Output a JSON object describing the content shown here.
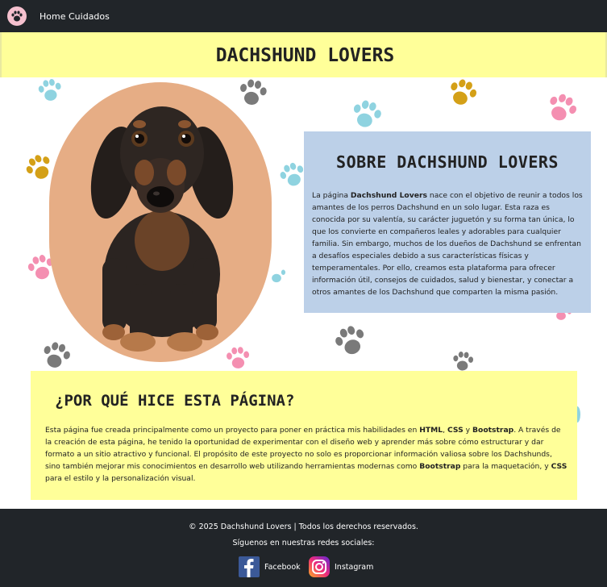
{
  "navbar": {
    "logo_icon": "paw-icon",
    "links": [
      "Home",
      "Cuidados"
    ]
  },
  "hero": {
    "title": "DACHSHUND LOVERS"
  },
  "about": {
    "title": "SOBRE DACHSHUND LOVERS",
    "text_parts": [
      "La página ",
      "Dachshund Lovers",
      " nace con el objetivo de reunir a todos los amantes de los perros Dachshund en un solo lugar. Esta raza es conocida por su valentía, su carácter juguetón y su forma tan única, lo que los convierte en compañeros leales y adorables para cualquier familia. Sin embargo, muchos de los dueños de Dachshund se enfrentan a desafíos especiales debido a sus características físicas y temperamentales. Por ello, creamos esta plataforma para ofrecer información útil, consejos de cuidados, salud y bienestar, y conectar a otros amantes de los Dachshund que comparten la misma pasión."
    ]
  },
  "why": {
    "title": "¿POR QUÉ HICE ESTA PÁGINA?",
    "text_parts": [
      "Esta página fue creada principalmente como un proyecto para poner en práctica mis habilidades en ",
      "HTML",
      ", ",
      "CSS",
      " y ",
      "Bootstrap",
      ". A través de la creación de esta página, he tenido la oportunidad de experimentar con el diseño web y aprender más sobre cómo estructurar y dar formato a un sitio atractivo y funcional. El propósito de este proyecto no solo es proporcionar información valiosa sobre los Dachshunds, sino también mejorar mis conocimientos en desarrollo web utilizando herramientas modernas como ",
      "Bootstrap",
      " para la maquetación, y ",
      "CSS",
      " para el estilo y la personalización visual."
    ]
  },
  "footer": {
    "copyright": "© 2025 Dachshund Lovers | Todos los derechos reservados.",
    "follow": "Síguenos en nuestras redes sociales:",
    "social": [
      {
        "label": "Facebook",
        "icon": "facebook-icon"
      },
      {
        "label": "Instagram",
        "icon": "instagram-icon"
      }
    ]
  },
  "colors": {
    "navbar": "#212529",
    "title_band": "#ffff99",
    "about_card": "#bcd0e8",
    "why_card": "#ffff99",
    "paw_pink": "#f48fb1",
    "paw_blue": "#8fd3e0",
    "paw_gray": "#7a7a7a",
    "paw_gold": "#d4a017"
  }
}
